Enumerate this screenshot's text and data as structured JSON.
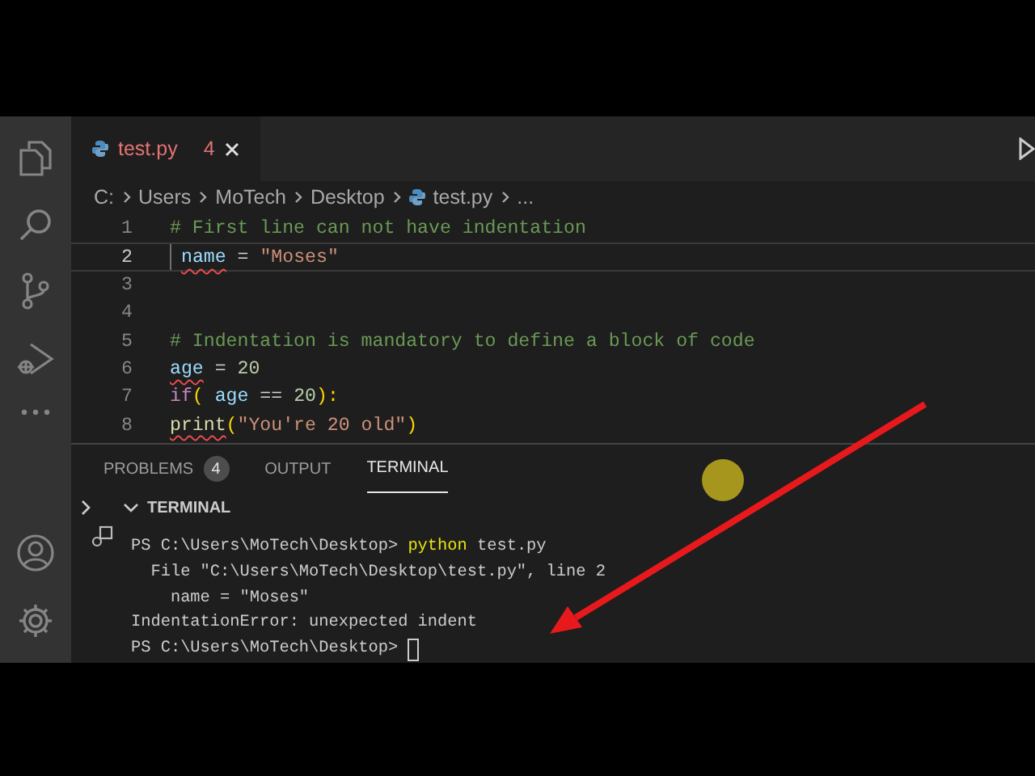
{
  "editor_tab": {
    "filename": "test.py",
    "problem_count": "4",
    "selected": true
  },
  "breadcrumb": [
    "C:",
    "Users",
    "MoTech",
    "Desktop",
    "test.py",
    "..."
  ],
  "code_lines": [
    {
      "number": "1",
      "current": false,
      "tokens": [
        {
          "text": "# First line can not have indentation",
          "kind": "comment",
          "squiggle": false
        }
      ]
    },
    {
      "number": "2",
      "current": true,
      "indent_guide": true,
      "tokens": [
        {
          "text": "name",
          "kind": "var",
          "squiggle": true
        },
        {
          "text": " = ",
          "kind": "op",
          "squiggle": false
        },
        {
          "text": "\"Moses\"",
          "kind": "str",
          "squiggle": false
        }
      ]
    },
    {
      "number": "3",
      "current": false
    },
    {
      "number": "4",
      "current": false
    },
    {
      "number": "5",
      "current": false,
      "tokens": [
        {
          "text": "# Indentation is mandatory to define a block of code",
          "kind": "comment",
          "squiggle": false
        }
      ]
    },
    {
      "number": "6",
      "current": false,
      "tokens": [
        {
          "text": "age",
          "kind": "var",
          "squiggle": true
        },
        {
          "text": " = ",
          "kind": "op",
          "squiggle": false
        },
        {
          "text": "20",
          "kind": "num",
          "squiggle": false
        }
      ]
    },
    {
      "number": "7",
      "current": false,
      "tokens": [
        {
          "text": "if",
          "kind": "kw",
          "squiggle": false
        },
        {
          "text": "( ",
          "kind": "punct",
          "squiggle": false
        },
        {
          "text": "age",
          "kind": "var",
          "squiggle": false
        },
        {
          "text": " == ",
          "kind": "op",
          "squiggle": false
        },
        {
          "text": "20",
          "kind": "num",
          "squiggle": false
        },
        {
          "text": "):",
          "kind": "punct",
          "squiggle": false
        }
      ]
    },
    {
      "number": "8",
      "current": false,
      "tokens": [
        {
          "text": "print",
          "kind": "fn",
          "squiggle": true
        },
        {
          "text": "(",
          "kind": "punct",
          "squiggle": false
        },
        {
          "text": "\"You're 20 old\"",
          "kind": "str",
          "squiggle": false
        },
        {
          "text": ")",
          "kind": "punct",
          "squiggle": false
        }
      ]
    }
  ],
  "panel_tabs": [
    {
      "label": "PROBLEMS",
      "badge": "4",
      "selected": false
    },
    {
      "label": "OUTPUT",
      "selected": false
    },
    {
      "label": "TERMINAL",
      "selected": true
    }
  ],
  "terminal": {
    "title": "TERMINAL",
    "expanded": true,
    "lines": [
      [
        {
          "text": "PS C:\\Users\\MoTech\\Desktop> ",
          "kind": "text"
        },
        {
          "text": "python",
          "kind": "cmd"
        },
        {
          "text": " test.py",
          "kind": "text"
        }
      ],
      [
        {
          "text": "  File \"C:\\Users\\MoTech\\Desktop\\test.py\", line 2",
          "kind": "text"
        }
      ],
      [
        {
          "text": "    name = \"Moses\"",
          "kind": "text"
        }
      ],
      [
        {
          "text": "IndentationError: unexpected indent",
          "kind": "text"
        }
      ],
      [
        {
          "text": "PS C:\\Users\\MoTech\\Desktop> ",
          "kind": "text"
        },
        {
          "kind": "cursor"
        }
      ]
    ]
  }
}
